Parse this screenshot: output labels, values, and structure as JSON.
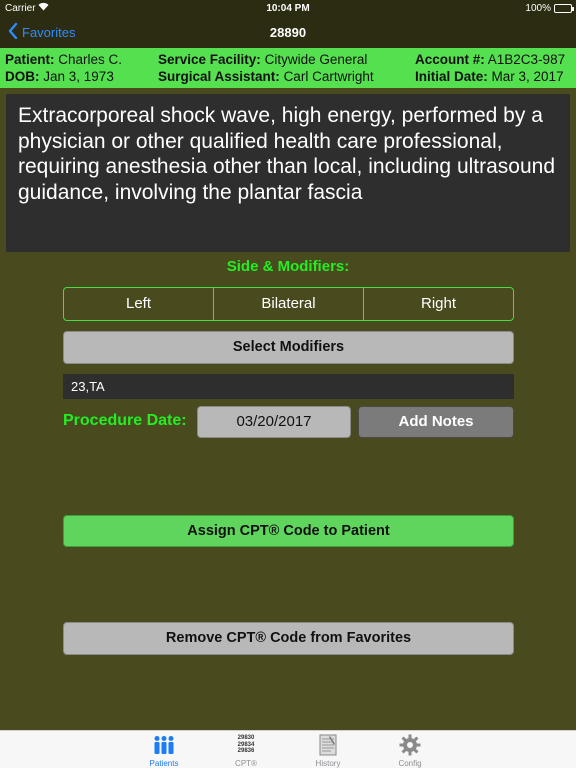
{
  "status_bar": {
    "carrier": "Carrier",
    "time": "10:04 PM",
    "battery": "100%"
  },
  "nav": {
    "back_label": "Favorites",
    "title": "28890",
    "back_color": "#2d8cff"
  },
  "patient": {
    "patient_label": "Patient:",
    "patient_value": "Charles C.",
    "dob_label": "DOB:",
    "dob_value": "Jan 3, 1973",
    "facility_label": "Service Facility:",
    "facility_value": "Citywide General",
    "assistant_label": "Surgical Assistant:",
    "assistant_value": "Carl Cartwright",
    "account_label": "Account #:",
    "account_value": "A1B2C3-987",
    "initial_label": "Initial Date:",
    "initial_value": "Mar 3, 2017",
    "bar_color": "#55e14f"
  },
  "description": "Extracorporeal shock wave, high energy, performed by a physician or other qualified health care professional, requiring anesthesia other than local, including ultrasound guidance, involving the plantar fascia",
  "side": {
    "title": "Side & Modifiers:",
    "options": [
      "Left",
      "Bilateral",
      "Right"
    ]
  },
  "select_modifiers_label": "Select Modifiers",
  "modifiers_value": "23,TA",
  "procedure": {
    "label": "Procedure Date:",
    "date": "03/20/2017",
    "notes_label": "Add Notes"
  },
  "assign_label": "Assign CPT® Code to Patient",
  "remove_label": "Remove CPT® Code from Favorites",
  "tabs": [
    {
      "label": "Patients",
      "icon": "patients-icon",
      "active": true
    },
    {
      "label": "CPT®",
      "icon": "cpt-codes-icon",
      "icon_text": [
        "29830",
        "29834",
        "29836"
      ]
    },
    {
      "label": "History",
      "icon": "history-icon"
    },
    {
      "label": "Config",
      "icon": "gear-icon"
    }
  ],
  "colors": {
    "background": "#4a4a1f",
    "accent_green": "#22ee22",
    "tab_active": "#1e7df2"
  }
}
